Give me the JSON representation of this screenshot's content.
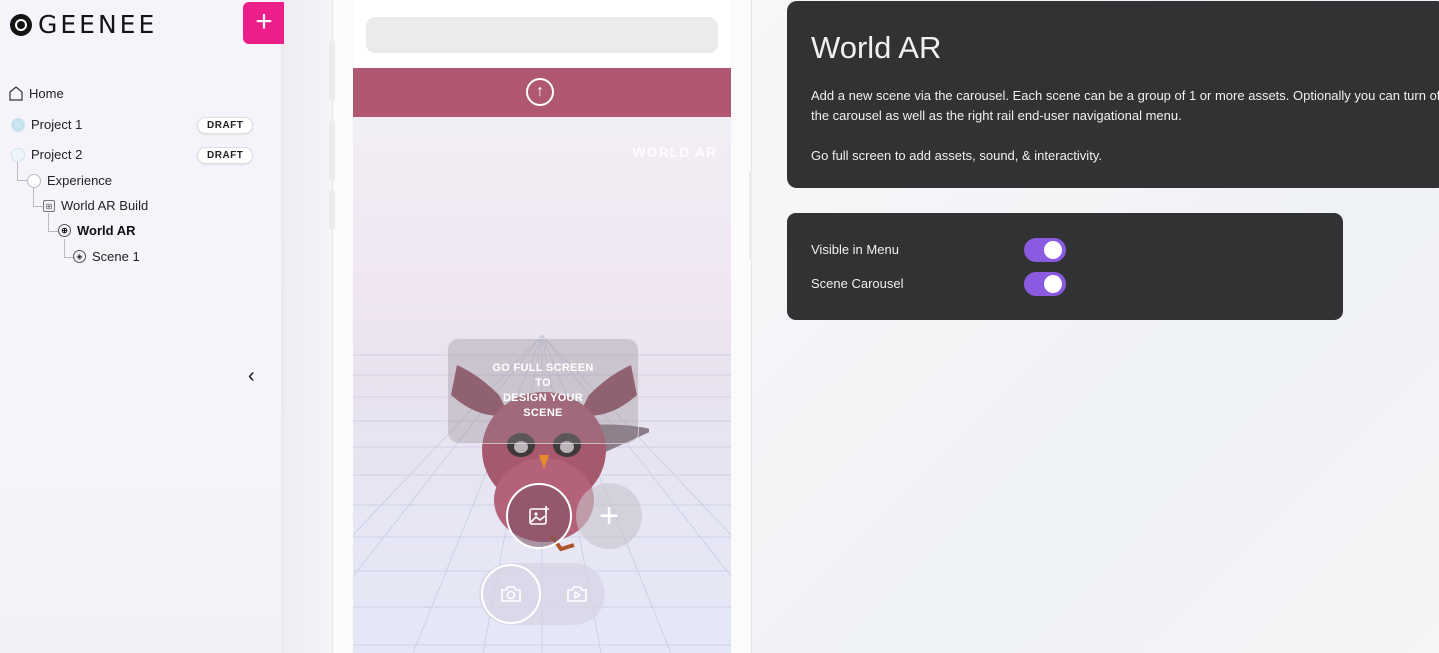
{
  "brand": {
    "name": "GEENEE"
  },
  "sidebar": {
    "add_label": "+",
    "collapse_label": "‹",
    "tree": [
      {
        "label": "Home",
        "icon": "home-icon"
      },
      {
        "label": "Project 1",
        "icon": "project-icon",
        "badge": "DRAFT"
      },
      {
        "label": "Project 2",
        "icon": "project-icon",
        "badge": "DRAFT"
      },
      {
        "label": "Experience",
        "icon": "experience-icon"
      },
      {
        "label": "World AR Build",
        "icon": "build-icon"
      },
      {
        "label": "World AR",
        "icon": "world-icon",
        "selected": true
      },
      {
        "label": "Scene 1",
        "icon": "scene-icon"
      }
    ]
  },
  "phone": {
    "upload_icon": "↑",
    "watermark": "WORLD AR",
    "overlay_lines": [
      "GO FULL SCREEN",
      "TO",
      "DESIGN YOUR",
      "SCENE"
    ],
    "plus_label": "+"
  },
  "info": {
    "title": "World AR",
    "paragraph1": "Add a new scene via the carousel. Each scene can be a group of 1 or more assets. Optionally you can turn off the carousel as well as the right rail end-user navigational menu.",
    "paragraph2": "Go full screen to add assets, sound, & interactivity."
  },
  "settings": {
    "visible_in_menu_label": "Visible in Menu",
    "visible_in_menu_on": true,
    "scene_carousel_label": "Scene Carousel",
    "scene_carousel_on": true
  },
  "colors": {
    "accent_pink": "#ec1e8a",
    "band": "#b05872",
    "card": "#323133",
    "toggle": "#8a5ae0"
  }
}
